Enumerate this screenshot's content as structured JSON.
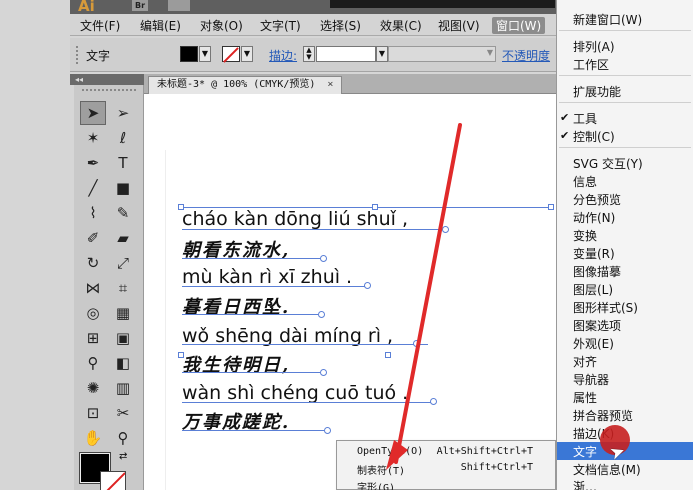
{
  "app": {
    "logo": "Ai",
    "br_badge": "Br"
  },
  "ad_strip": "",
  "menubar": {
    "items": [
      "文件(F)",
      "编辑(E)",
      "对象(O)",
      "文字(T)",
      "选择(S)",
      "效果(C)",
      "视图(V)",
      "窗口(W)"
    ]
  },
  "controlbar": {
    "label": "文字",
    "stroke_label": "描边:",
    "opacity_label": "不透明度"
  },
  "document": {
    "tab_title": "未标题-3* @ 100% (CMYK/预览)",
    "tab_close": "×"
  },
  "text_lines": [
    "cháo kàn dōng liú shuǐ ,",
    "朝看东流水,",
    "mù kàn rì xī zhuì .",
    "暮看日西坠.",
    "wǒ shēng dài míng rì ,",
    "我生待明日,",
    "wàn shì chéng cuō tuó .",
    "万事成蹉跎."
  ],
  "submenu": {
    "items": [
      {
        "label": "OpenType(O)",
        "shortcut": "Alt+Shift+Ctrl+T"
      },
      {
        "label": "制表符(T)",
        "shortcut": "Shift+Ctrl+T"
      },
      {
        "label": "字形(G)",
        "shortcut": ""
      }
    ]
  },
  "window_menu": {
    "items": [
      {
        "label": "新建窗口(W)",
        "checked": false
      },
      {
        "label": "排列(A)",
        "checked": false
      },
      {
        "label": "工作区",
        "checked": false
      },
      {
        "label": "扩展功能",
        "checked": false
      },
      {
        "label": "工具",
        "checked": true
      },
      {
        "label": "控制(C)",
        "checked": true
      },
      {
        "label": "SVG 交互(Y)",
        "checked": false
      },
      {
        "label": "信息",
        "checked": false
      },
      {
        "label": "分色预览",
        "checked": false
      },
      {
        "label": "动作(N)",
        "checked": false
      },
      {
        "label": "变换",
        "checked": false
      },
      {
        "label": "变量(R)",
        "checked": false
      },
      {
        "label": "图像描摹",
        "checked": false
      },
      {
        "label": "图层(L)",
        "checked": false
      },
      {
        "label": "图形样式(S)",
        "checked": false
      },
      {
        "label": "图案选项",
        "checked": false
      },
      {
        "label": "外观(E)",
        "checked": false
      },
      {
        "label": "对齐",
        "checked": false
      },
      {
        "label": "导航器",
        "checked": false
      },
      {
        "label": "属性",
        "checked": false
      },
      {
        "label": "拼合器预览",
        "checked": false
      },
      {
        "label": "描边(K)",
        "checked": false
      },
      {
        "label": "文字",
        "checked": false,
        "highlighted": true
      },
      {
        "label": "文档信息(M)",
        "checked": false
      },
      {
        "label": "渐…",
        "checked": false
      }
    ]
  },
  "colors": {
    "accent": "#3a77d6",
    "annotation_arrow": "#e02a2a",
    "text_frame": "#5a7fd6"
  },
  "icons": [
    "selection-arrow-icon",
    "direct-selection-icon",
    "magic-wand-icon",
    "lasso-icon",
    "pen-icon",
    "type-icon",
    "line-icon",
    "rectangle-icon",
    "paintbrush-icon",
    "pencil-icon",
    "blob-brush-icon",
    "eraser-icon",
    "rotate-icon",
    "scale-icon",
    "width-icon",
    "free-transform-icon",
    "shape-builder-icon",
    "perspective-grid-icon",
    "mesh-icon",
    "gradient-icon",
    "eyedropper-icon",
    "blend-icon",
    "symbol-sprayer-icon",
    "column-graph-icon",
    "artboard-icon",
    "slice-icon",
    "hand-icon",
    "zoom-icon"
  ]
}
